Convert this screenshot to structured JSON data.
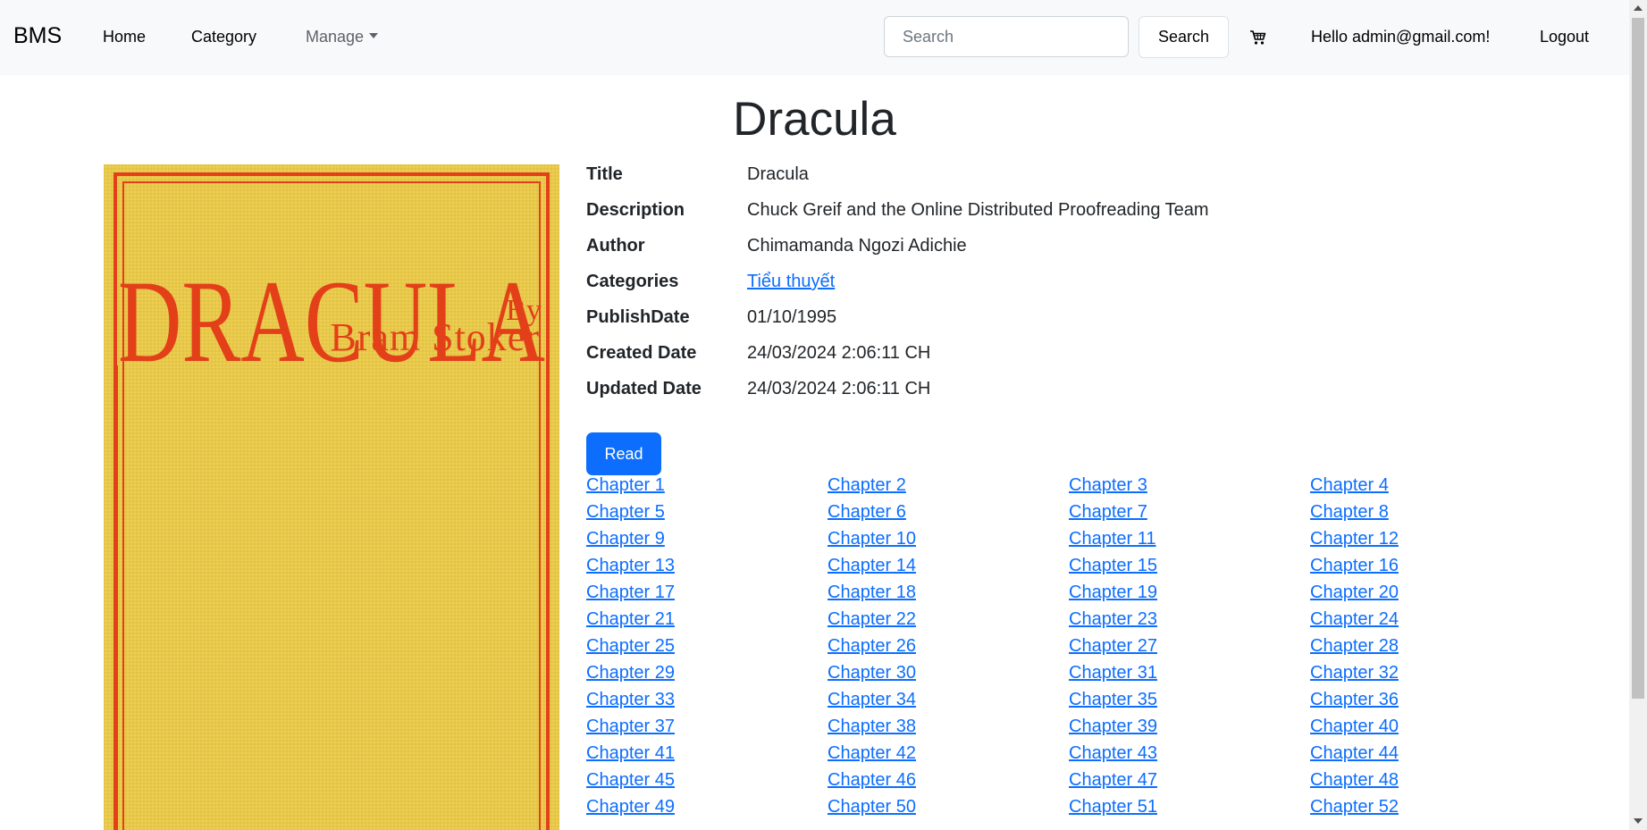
{
  "nav": {
    "brand": "BMS",
    "home": "Home",
    "category": "Category",
    "manage": "Manage",
    "search_placeholder": "Search",
    "search_button": "Search",
    "cart_icon": "cart-icon",
    "greeting": "Hello admin@gmail.com!",
    "logout": "Logout"
  },
  "page": {
    "title": "Dracula"
  },
  "cover": {
    "title_text": "DRACULA",
    "by_text": "By",
    "author_text": "Bram Stoker",
    "colors": {
      "background": "#e8c94a",
      "text": "#e3401a"
    }
  },
  "details": [
    {
      "label": "Title",
      "value": "Dracula"
    },
    {
      "label": "Description",
      "value": "Chuck Greif and the Online Distributed Proofreading Team"
    },
    {
      "label": "Author",
      "value": "Chimamanda Ngozi Adichie"
    },
    {
      "label": "Categories",
      "value": "Tiểu thuyết"
    },
    {
      "label": "PublishDate",
      "value": "01/10/1995"
    },
    {
      "label": "Created Date",
      "value": "24/03/2024 2:06:11 CH"
    },
    {
      "label": "Updated Date",
      "value": "24/03/2024 2:06:11 CH"
    }
  ],
  "read_button": "Read",
  "chapters": [
    "Chapter 1",
    "Chapter 2",
    "Chapter 3",
    "Chapter 4",
    "Chapter 5",
    "Chapter 6",
    "Chapter 7",
    "Chapter 8",
    "Chapter 9",
    "Chapter 10",
    "Chapter 11",
    "Chapter 12",
    "Chapter 13",
    "Chapter 14",
    "Chapter 15",
    "Chapter 16",
    "Chapter 17",
    "Chapter 18",
    "Chapter 19",
    "Chapter 20",
    "Chapter 21",
    "Chapter 22",
    "Chapter 23",
    "Chapter 24",
    "Chapter 25",
    "Chapter 26",
    "Chapter 27",
    "Chapter 28",
    "Chapter 29",
    "Chapter 30",
    "Chapter 31",
    "Chapter 32",
    "Chapter 33",
    "Chapter 34",
    "Chapter 35",
    "Chapter 36",
    "Chapter 37",
    "Chapter 38",
    "Chapter 39",
    "Chapter 40",
    "Chapter 41",
    "Chapter 42",
    "Chapter 43",
    "Chapter 44",
    "Chapter 45",
    "Chapter 46",
    "Chapter 47",
    "Chapter 48",
    "Chapter 49",
    "Chapter 50",
    "Chapter 51",
    "Chapter 52"
  ],
  "colors": {
    "navbar_bg": "#f8f9fa",
    "primary": "#0d6efd",
    "text": "#212529"
  }
}
